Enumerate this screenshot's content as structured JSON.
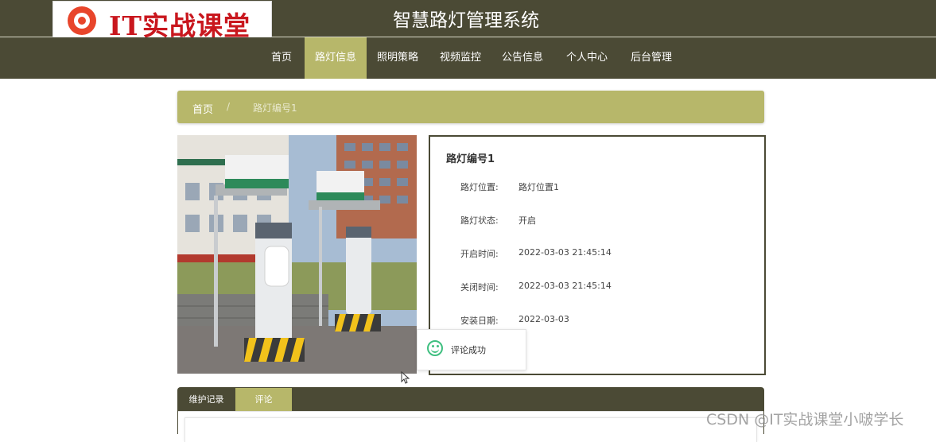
{
  "header": {
    "logo_text": "IT实战课堂",
    "site_title": "智慧路灯管理系统"
  },
  "nav": {
    "items": [
      {
        "label": "首页"
      },
      {
        "label": "路灯信息"
      },
      {
        "label": "照明策略"
      },
      {
        "label": "视频监控"
      },
      {
        "label": "公告信息"
      },
      {
        "label": "个人中心"
      },
      {
        "label": "后台管理"
      }
    ],
    "active_index": 1
  },
  "breadcrumb": {
    "home": "首页",
    "separator": "/",
    "current": "路灯编号1"
  },
  "detail": {
    "title": "路灯编号1",
    "fields": [
      {
        "label": "路灯位置:",
        "value": "路灯位置1"
      },
      {
        "label": "路灯状态:",
        "value": "开启"
      },
      {
        "label": "开启时间:",
        "value": "2022-03-03 21:45:14"
      },
      {
        "label": "关闭时间:",
        "value": "2022-03-03 21:45:14"
      },
      {
        "label": "安装日期:",
        "value": "2022-03-03"
      }
    ]
  },
  "toast": {
    "message": "评论成功",
    "icon": "smile-icon"
  },
  "tabs": {
    "items": [
      {
        "label": "维护记录"
      },
      {
        "label": "评论"
      }
    ],
    "active_index": 1
  },
  "watermark": "CSDN @IT实战课堂小啵学长",
  "colors": {
    "primary_dark": "#4b4a35",
    "accent": "#b7b76a",
    "logo_red": "#c9171e",
    "success": "#3fbf80"
  }
}
